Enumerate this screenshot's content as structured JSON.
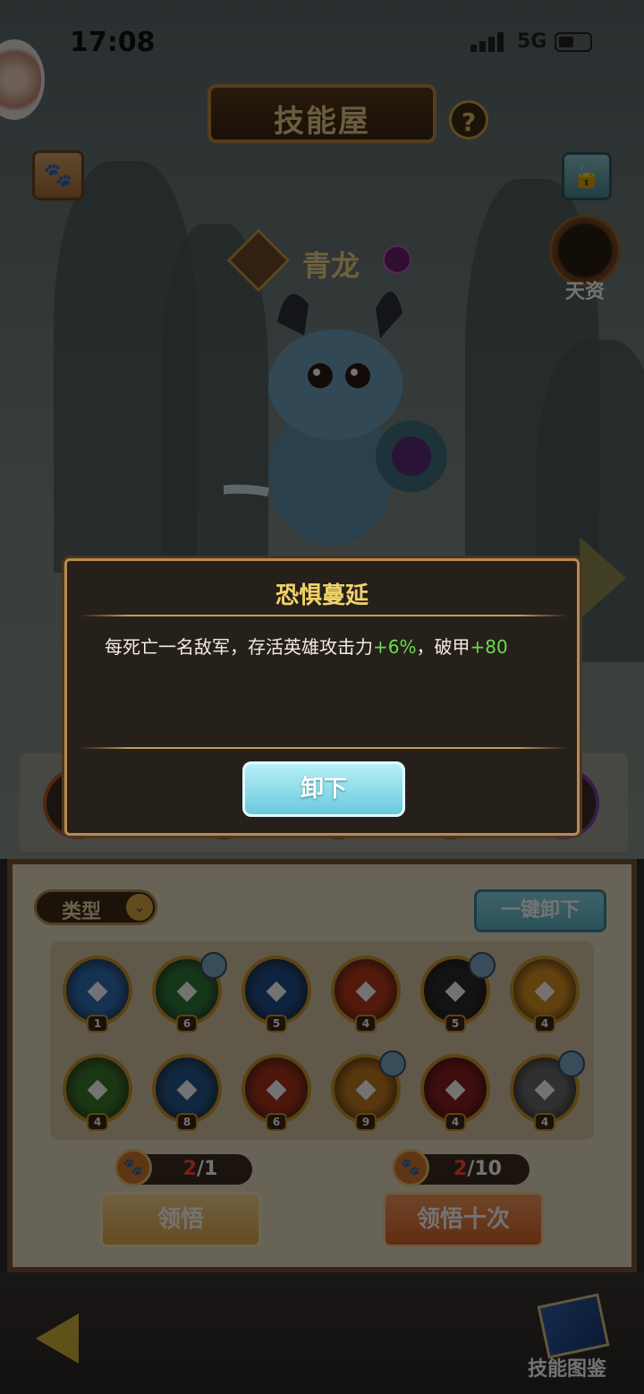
{
  "status_bar": {
    "time": "17:08",
    "network": "5G"
  },
  "header": {
    "title": "技能屋",
    "help": "?"
  },
  "talent": {
    "label": "天资"
  },
  "hero": {
    "name": "青龙"
  },
  "dialog": {
    "title": "恐惧蔓延",
    "description_prefix": "每死亡一名敌军，存活英雄攻击力",
    "attack_bonus": "+6%",
    "description_mid": "，破甲",
    "armor_break": "+80",
    "unequip_button": "卸下"
  },
  "panel": {
    "type_filter": "类型",
    "unequip_all": "一键卸下",
    "skills": [
      {
        "icon": "water-wave-skill-icon",
        "level": "1",
        "color": "#2f6fb8",
        "tag": false
      },
      {
        "icon": "leaf-skill-icon",
        "level": "6",
        "color": "#2e7a3a",
        "tag": true
      },
      {
        "icon": "water-skill-icon",
        "level": "5",
        "color": "#1f4f8c",
        "tag": false
      },
      {
        "icon": "fire-skill-icon",
        "level": "4",
        "color": "#b83a1c",
        "tag": false
      },
      {
        "icon": "moon-skill-icon",
        "level": "5",
        "color": "#2b2b2b",
        "tag": true
      },
      {
        "icon": "sun-skill-icon",
        "level": "4",
        "color": "#d8901f",
        "tag": false
      },
      {
        "icon": "wing-boot-skill-icon",
        "level": "4",
        "color": "#3b7a2c",
        "tag": false
      },
      {
        "icon": "mind-skill-icon",
        "level": "8",
        "color": "#255a8c",
        "tag": false
      },
      {
        "icon": "fist-skill-icon",
        "level": "6",
        "color": "#a8321a",
        "tag": false
      },
      {
        "icon": "explosion-skill-icon",
        "level": "9",
        "color": "#c07a1d",
        "tag": true
      },
      {
        "icon": "warrior-skill-icon",
        "level": "4",
        "color": "#8a1d1d",
        "tag": false
      },
      {
        "icon": "stone-golem-skill-icon",
        "level": "4",
        "color": "#6b6b6b",
        "tag": true
      }
    ],
    "comprehend_counter": {
      "current": "2",
      "total": "/1"
    },
    "comprehend_ten_counter": {
      "current": "2",
      "total": "/10"
    },
    "comprehend_button": "领悟",
    "comprehend_ten_button": "领悟十次"
  },
  "footer": {
    "codex_label": "技能图鉴"
  }
}
